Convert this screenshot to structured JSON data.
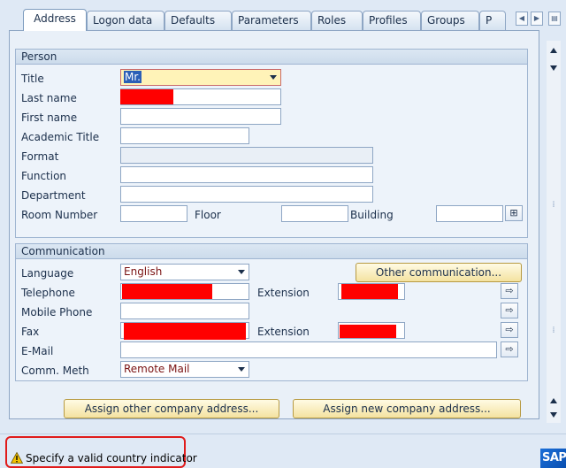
{
  "tabs": [
    {
      "label": "Address",
      "active": true
    },
    {
      "label": "Logon data"
    },
    {
      "label": "Defaults"
    },
    {
      "label": "Parameters"
    },
    {
      "label": "Roles"
    },
    {
      "label": "Profiles"
    },
    {
      "label": "Groups"
    },
    {
      "label": "P"
    }
  ],
  "person": {
    "group_title": "Person",
    "title_label": "Title",
    "title_value": "Mr.",
    "last_name_label": "Last name",
    "first_name_label": "First name",
    "academic_title_label": "Academic Title",
    "format_label": "Format",
    "function_label": "Function",
    "department_label": "Department",
    "room_number_label": "Room Number",
    "floor_label": "Floor",
    "building_label": "Building"
  },
  "communication": {
    "group_title": "Communication",
    "language_label": "Language",
    "language_value": "English",
    "other_comm_button": "Other communication...",
    "telephone_label": "Telephone",
    "extension_label": "Extension",
    "mobile_label": "Mobile Phone",
    "fax_label": "Fax",
    "fax_extension_label": "Extension",
    "email_label": "E-Mail",
    "comm_meth_label": "Comm. Meth",
    "comm_meth_value": "Remote Mail"
  },
  "buttons": {
    "assign_other": "Assign other company address...",
    "assign_new": "Assign new company address..."
  },
  "status": {
    "message": "Specify a valid country indicator"
  },
  "logo": {
    "text": "SAP"
  },
  "colors": {
    "accent": "#2b5fb7",
    "warning": "#f2c200",
    "highlight_box": "#e01b1b",
    "redaction": "#ff0000"
  }
}
